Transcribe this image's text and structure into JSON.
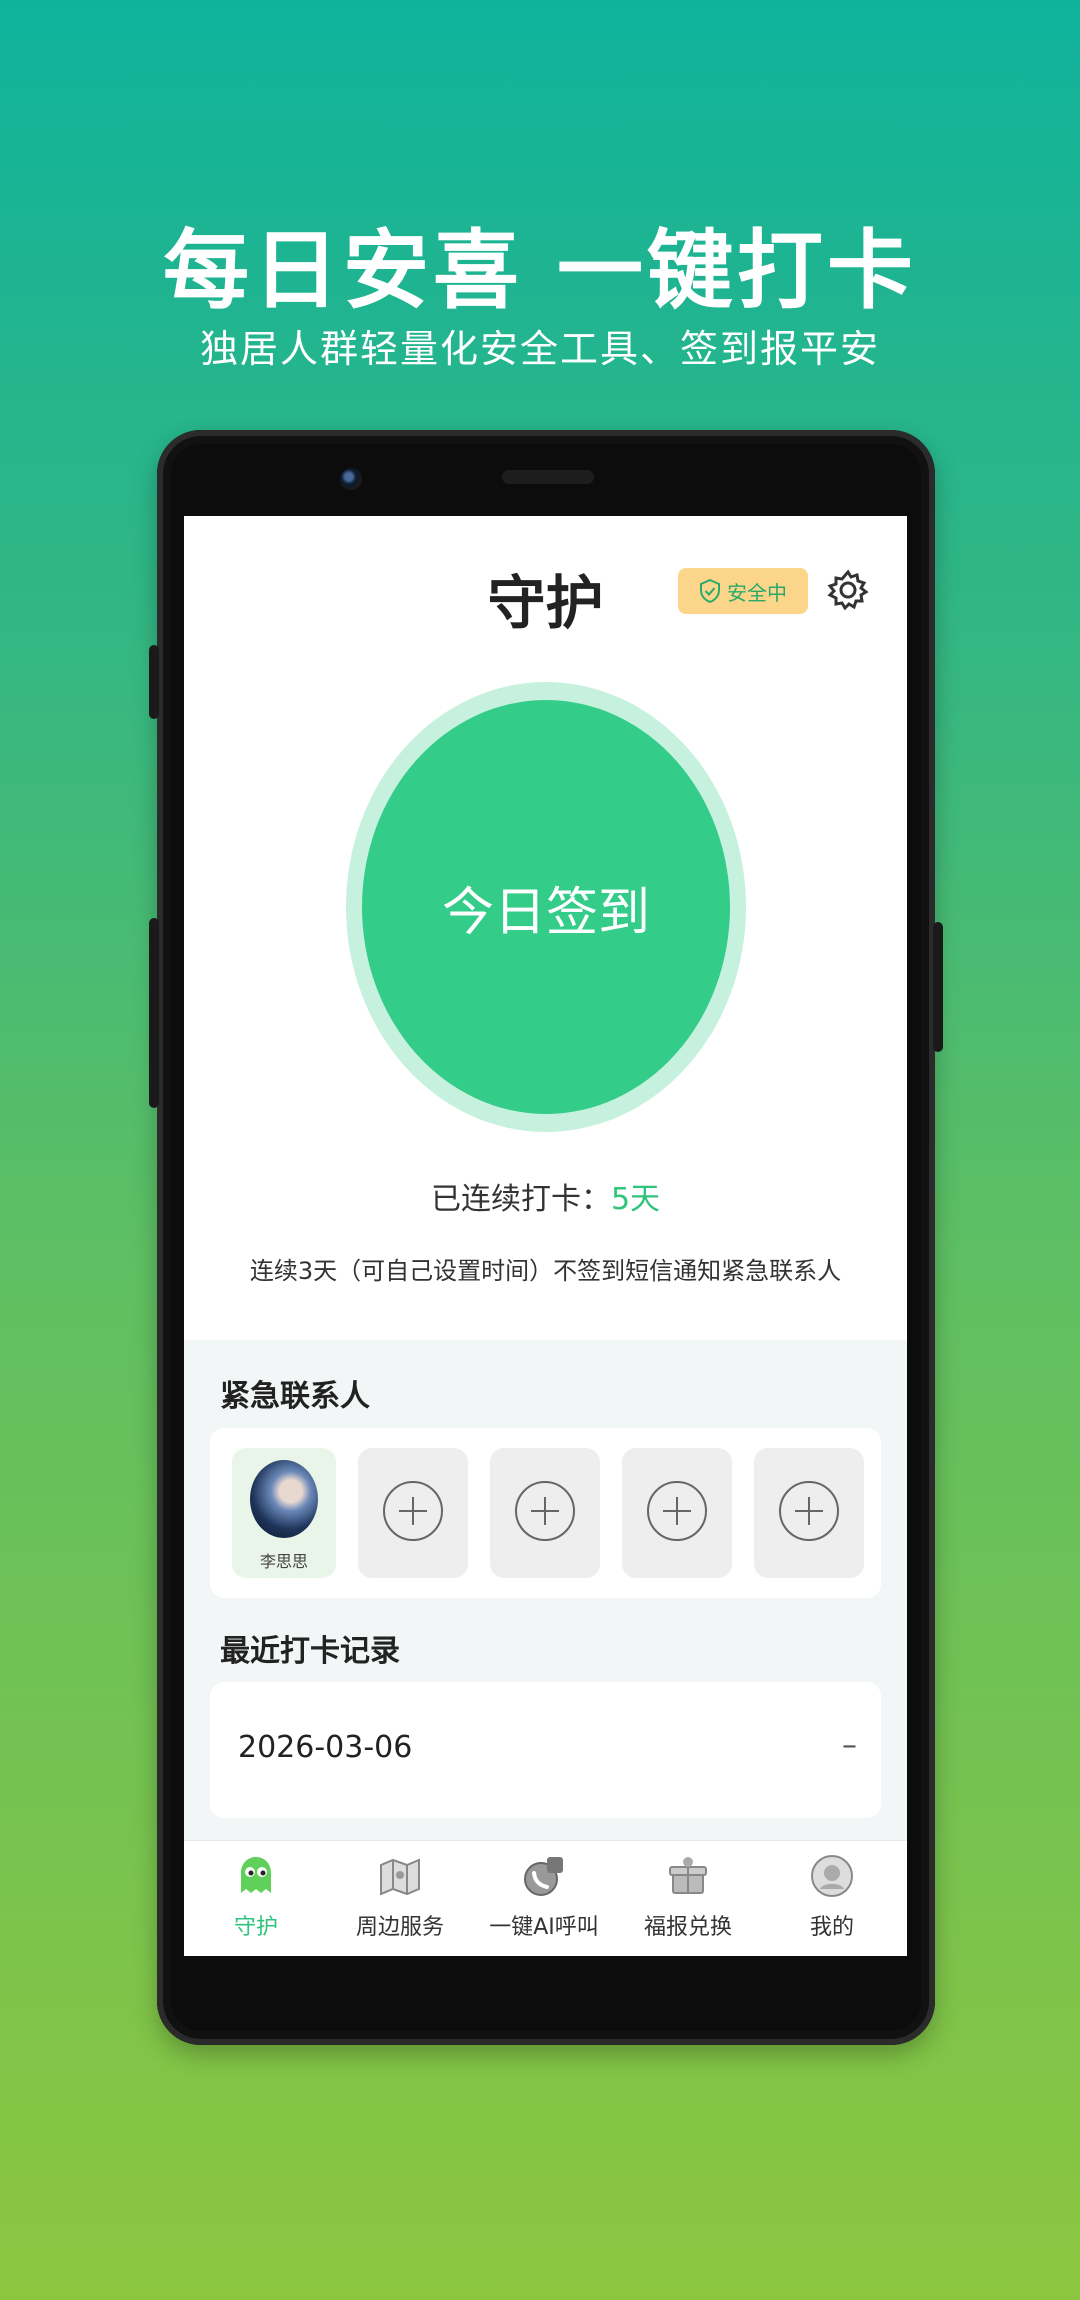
{
  "promo": {
    "headline": "每日安喜 一键打卡",
    "subline": "独居人群轻量化安全工具、签到报平安"
  },
  "header": {
    "title": "守护",
    "badge": "安全中",
    "badge_icon": "shield-check-icon",
    "settings_icon": "gear-icon"
  },
  "checkin": {
    "button_label": "今日签到",
    "streak_label": "已连续打卡：",
    "streak_value": "5天",
    "notice": "连续3天（可自己设置时间）不签到短信通知紧急联系人"
  },
  "contacts": {
    "title": "紧急联系人",
    "items": [
      {
        "name": "李思思",
        "type": "contact"
      },
      {
        "type": "add",
        "icon": "plus-circle-icon"
      },
      {
        "type": "add",
        "icon": "plus-circle-icon"
      },
      {
        "type": "add",
        "icon": "plus-circle-icon"
      },
      {
        "type": "add",
        "icon": "plus-circle-icon"
      }
    ]
  },
  "records": {
    "title": "最近打卡记录",
    "items": [
      {
        "date": "2026-03-06",
        "status": "–"
      }
    ]
  },
  "nav": {
    "items": [
      {
        "label": "守护",
        "icon": "ghost-mascot-icon",
        "active": true
      },
      {
        "label": "周边服务",
        "icon": "map-icon",
        "active": false
      },
      {
        "label": "一键AI呼叫",
        "icon": "phone-call-icon",
        "active": false
      },
      {
        "label": "福报兑换",
        "icon": "gift-icon",
        "active": false
      },
      {
        "label": "我的",
        "icon": "profile-icon",
        "active": false
      }
    ]
  },
  "colors": {
    "accent": "#33cc88",
    "accent_text": "#2fc47c",
    "badge_bg": "#fbd58a"
  }
}
